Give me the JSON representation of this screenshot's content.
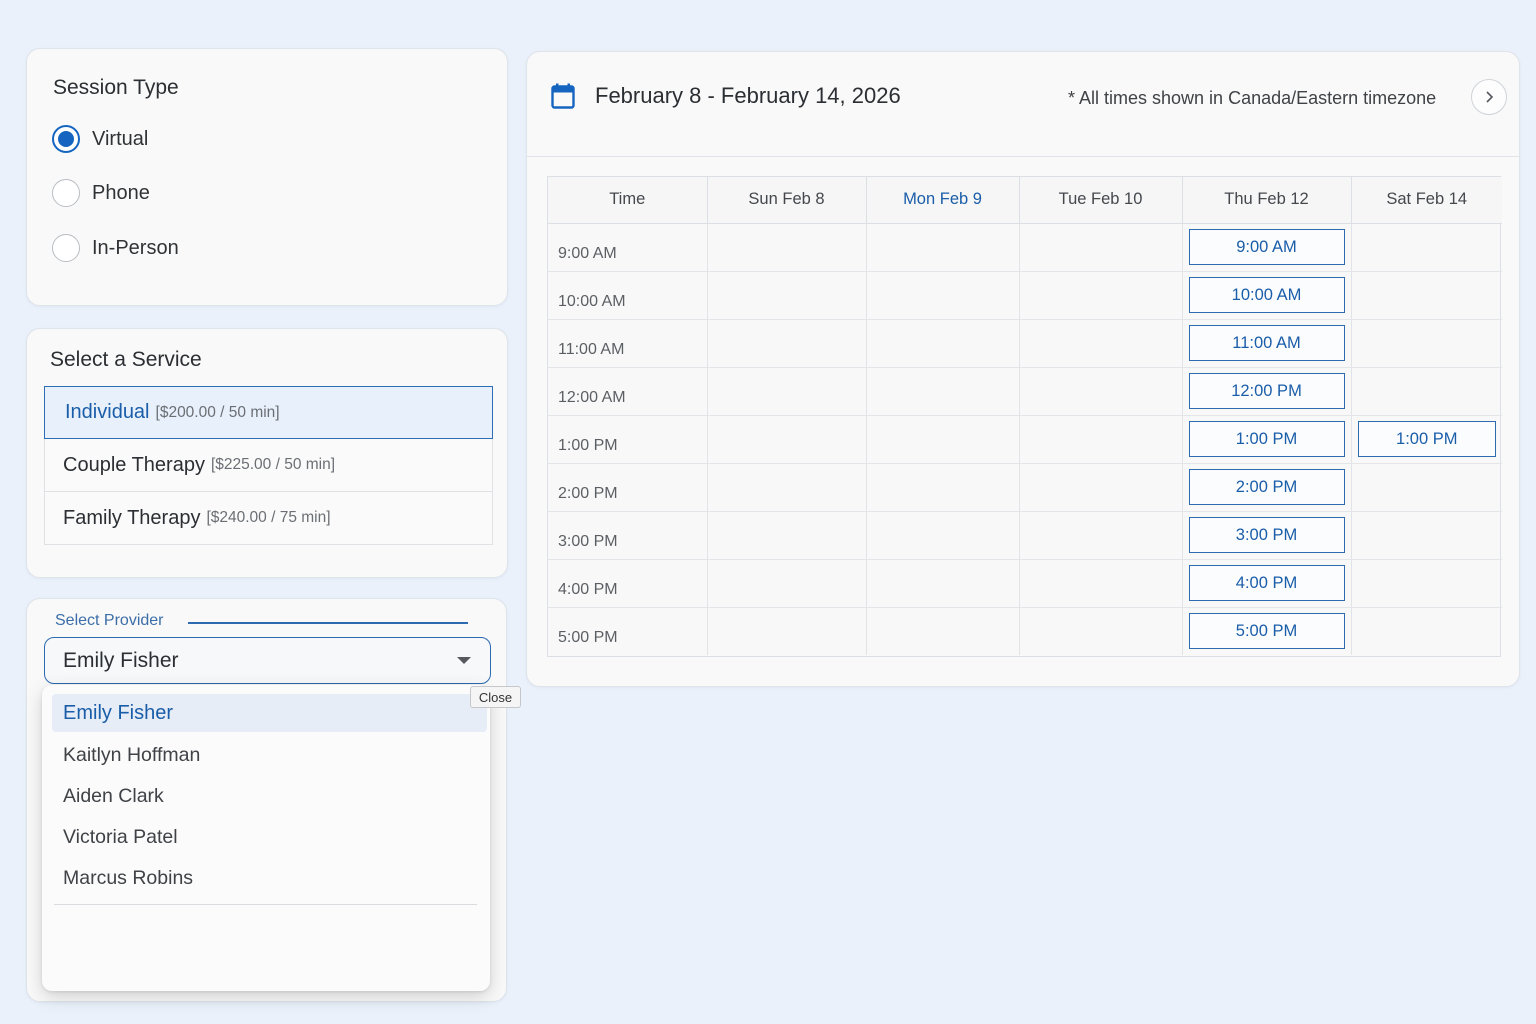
{
  "session": {
    "title": "Session Type",
    "options": [
      {
        "label": "Virtual",
        "checked": true
      },
      {
        "label": "Phone",
        "checked": false
      },
      {
        "label": "In-Person",
        "checked": false
      }
    ]
  },
  "service": {
    "title": "Select a Service",
    "items": [
      {
        "name": "Individual",
        "price": "[$200.00 / 50 min]",
        "selected": true
      },
      {
        "name": "Couple Therapy",
        "price": "[$225.00 / 50 min]",
        "selected": false
      },
      {
        "name": "Family Therapy",
        "price": "[$240.00 / 75 min]",
        "selected": false
      }
    ]
  },
  "provider": {
    "legend": "Select Provider",
    "selected": "Emily Fisher",
    "options": [
      "Emily Fisher",
      "Kaitlyn Hoffman",
      "Aiden Clark",
      "Victoria Patel",
      "Marcus Robins"
    ],
    "close_tooltip": "Close"
  },
  "calendar": {
    "range_title": "February 8 - February 14, 2026",
    "timezone_note": "* All times shown in Canada/Eastern timezone",
    "accent_color": "#1565c0",
    "columns": [
      "Time",
      "Sun Feb 8",
      "Mon Feb 9",
      "Tue Feb 10",
      "Thu Feb 12",
      "Sat Feb 14"
    ],
    "today_column": "Mon Feb 9",
    "rows": [
      {
        "time": "9:00 AM",
        "slots": [
          "",
          "",
          "",
          "9:00 AM",
          ""
        ]
      },
      {
        "time": "10:00 AM",
        "slots": [
          "",
          "",
          "",
          "10:00 AM",
          ""
        ]
      },
      {
        "time": "11:00 AM",
        "slots": [
          "",
          "",
          "",
          "11:00 AM",
          ""
        ]
      },
      {
        "time": "12:00 AM",
        "slots": [
          "",
          "",
          "",
          "12:00 PM",
          ""
        ]
      },
      {
        "time": "1:00 PM",
        "slots": [
          "",
          "",
          "",
          "1:00 PM",
          "1:00 PM"
        ]
      },
      {
        "time": "2:00 PM",
        "slots": [
          "",
          "",
          "",
          "2:00 PM",
          ""
        ]
      },
      {
        "time": "3:00 PM",
        "slots": [
          "",
          "",
          "",
          "3:00 PM",
          ""
        ]
      },
      {
        "time": "4:00 PM",
        "slots": [
          "",
          "",
          "",
          "4:00 PM",
          ""
        ]
      },
      {
        "time": "5:00 PM",
        "slots": [
          "",
          "",
          "",
          "5:00 PM",
          ""
        ]
      }
    ]
  }
}
